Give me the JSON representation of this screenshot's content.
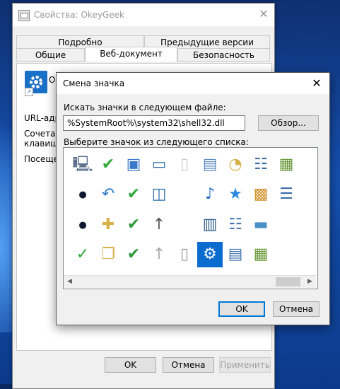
{
  "props_window": {
    "title": "Свойства: OkeyGeek",
    "close_glyph": "✕",
    "tabs_back": [
      "Подробно",
      "Предыдущие версии"
    ],
    "tabs_front": [
      "Общие",
      "Веб-документ",
      "Безопасность"
    ],
    "active_tab": "Веб-документ",
    "panel_letter": "О",
    "labels": {
      "url": "URL-адре",
      "shortcut1": "Сочетани",
      "shortcut2": "клавиш:",
      "visits": "Посещен"
    },
    "buttons": {
      "ok": "OK",
      "cancel": "Отмена",
      "apply": "Применить"
    }
  },
  "dialog": {
    "title": "Смена значка",
    "close_glyph": "✕",
    "search_label": "Искать значки в следующем файле:",
    "file_path": "%SystemRoot%\\system32\\shell32.dll",
    "browse_label": "Обзор...",
    "list_label": "Выберите значок из следующего списка:",
    "ok_label": "OK",
    "cancel_label": "Отмена",
    "scroll_left": "◀",
    "scroll_right": "▶"
  },
  "icons": [
    [
      "magnifier-computer-icon",
      "checkmark-icon",
      "media-document-icon",
      "window-panel-icon",
      "blank-folder-icon",
      "document-icon",
      "folder-clock-icon",
      "network-list-icon",
      "image-gallery-icon"
    ],
    [
      "dot-icon",
      "undo-arrow-icon",
      "checkmark-icon",
      "window-split-icon",
      "",
      "music-note-icon",
      "star-icon",
      "photo-film-icon",
      "list-lines-icon"
    ],
    [
      "dot-icon",
      "folder-add-icon",
      "users-check-icon",
      "up-arrow-icon",
      "",
      "film-doc-icon",
      "list-view-icon",
      "landscape-icon",
      ""
    ],
    [
      "documents-check-icon",
      "copy-files-icon",
      "users-check-icon",
      "up-arrow-grey-icon",
      "blank-page-icon",
      "gear-icon",
      "picture-list-icon",
      "image-grid-icon",
      ""
    ]
  ]
}
